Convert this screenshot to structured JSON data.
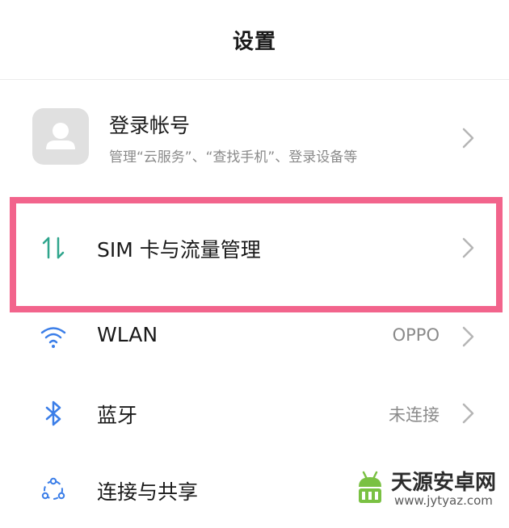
{
  "header": {
    "title": "设置"
  },
  "account": {
    "title": "登录帐号",
    "subtitle": "管理“云服务”、“查找手机”、登录设备等",
    "icon": "avatar-placeholder-icon"
  },
  "rows": [
    {
      "label": "SIM 卡与流量管理",
      "value": "",
      "icon": "data-transfer-icon",
      "icon_color": "#2fa58c"
    },
    {
      "label": "WLAN",
      "value": "OPPO",
      "icon": "wifi-icon",
      "icon_color": "#3b7ee8"
    },
    {
      "label": "蓝牙",
      "value": "未连接",
      "icon": "bluetooth-icon",
      "icon_color": "#3b7ee8"
    },
    {
      "label": "连接与共享",
      "value": "",
      "icon": "share-connection-icon",
      "icon_color": "#3b7ee8"
    }
  ],
  "highlight": {
    "color": "#f2648c"
  },
  "watermark": {
    "text": "天源安卓网",
    "url": "www.jytyaz.com"
  }
}
